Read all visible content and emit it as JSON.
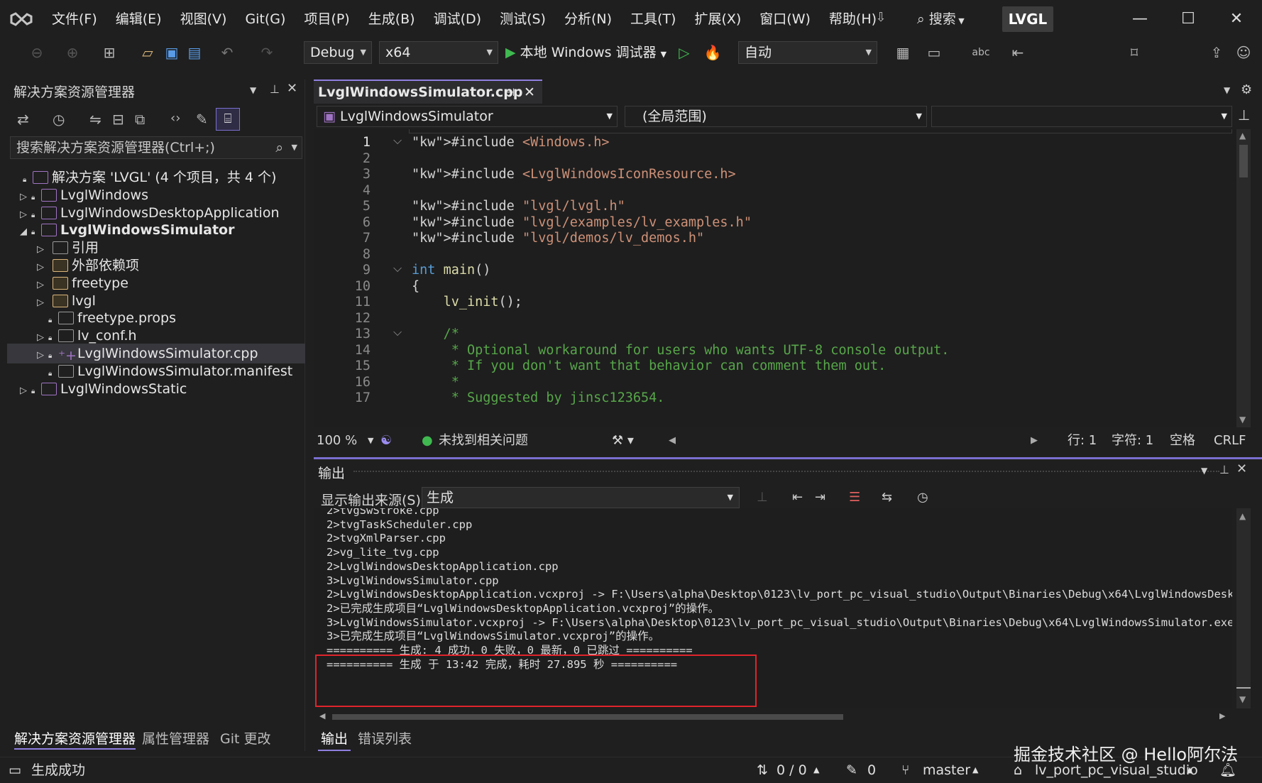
{
  "menu": [
    "文件(F)",
    "编辑(E)",
    "视图(V)",
    "Git(G)",
    "项目(P)",
    "生成(B)",
    "调试(D)",
    "测试(S)",
    "分析(N)",
    "工具(T)",
    "扩展(X)",
    "窗口(W)",
    "帮助(H)"
  ],
  "search_label": "搜索",
  "title_badge": "LVGL",
  "toolbar": {
    "config": "Debug",
    "platform": "x64",
    "debugger": "本地 Windows 调试器",
    "auto": "自动"
  },
  "solution_explorer": {
    "title": "解决方案资源管理器",
    "search_placeholder": "搜索解决方案资源管理器(Ctrl+;)",
    "tree": [
      {
        "label": "解决方案 'LVGL' (4 个项目，共 4 个)",
        "level": 0,
        "expander": "",
        "bold": false
      },
      {
        "label": "LvglWindows",
        "level": 1,
        "expander": "▷",
        "bold": false
      },
      {
        "label": "LvglWindowsDesktopApplication",
        "level": 1,
        "expander": "▷",
        "bold": false
      },
      {
        "label": "LvglWindowsSimulator",
        "level": 1,
        "expander": "◢",
        "bold": true
      },
      {
        "label": "引用",
        "level": 2,
        "expander": "▷",
        "bold": false
      },
      {
        "label": "外部依赖项",
        "level": 2,
        "expander": "▷",
        "bold": false
      },
      {
        "label": "freetype",
        "level": 2,
        "expander": "▷",
        "bold": false
      },
      {
        "label": "lvgl",
        "level": 2,
        "expander": "▷",
        "bold": false
      },
      {
        "label": "freetype.props",
        "level": 2,
        "expander": "",
        "bold": false
      },
      {
        "label": "lv_conf.h",
        "level": 2,
        "expander": "▷",
        "bold": false
      },
      {
        "label": "LvglWindowsSimulator.cpp",
        "level": 2,
        "expander": "▷",
        "bold": false
      },
      {
        "label": "LvglWindowsSimulator.manifest",
        "level": 2,
        "expander": "",
        "bold": false
      },
      {
        "label": "LvglWindowsStatic",
        "level": 1,
        "expander": "▷",
        "bold": false
      }
    ],
    "bottom_tabs": [
      "解决方案资源管理器",
      "属性管理器",
      "Git 更改"
    ]
  },
  "editor": {
    "tab": "LvglWindowsSimulator.cpp",
    "nav_project": "LvglWindowsSimulator",
    "nav_scope": "(全局范围)",
    "lines": [
      {
        "n": "1",
        "t": "#include <Windows.h>"
      },
      {
        "n": "2",
        "t": ""
      },
      {
        "n": "3",
        "t": "#include <LvglWindowsIconResource.h>"
      },
      {
        "n": "4",
        "t": ""
      },
      {
        "n": "5",
        "t": "#include \"lvgl/lvgl.h\""
      },
      {
        "n": "6",
        "t": "#include \"lvgl/examples/lv_examples.h\""
      },
      {
        "n": "7",
        "t": "#include \"lvgl/demos/lv_demos.h\""
      },
      {
        "n": "8",
        "t": ""
      },
      {
        "n": "9",
        "t": "int main()"
      },
      {
        "n": "10",
        "t": "{"
      },
      {
        "n": "11",
        "t": "    lv_init();"
      },
      {
        "n": "12",
        "t": ""
      },
      {
        "n": "13",
        "t": "    /*"
      },
      {
        "n": "14",
        "t": "     * Optional workaround for users who wants UTF-8 console output."
      },
      {
        "n": "15",
        "t": "     * If you don't want that behavior can comment them out."
      },
      {
        "n": "16",
        "t": "     *"
      },
      {
        "n": "17",
        "t": "     * Suggested by jinsc123654."
      }
    ],
    "zoom": "100 %",
    "issues": "未找到相关问题",
    "row": "行: 1",
    "col": "字符: 1",
    "spaces": "空格",
    "eol": "CRLF"
  },
  "output": {
    "title": "输出",
    "source_label": "显示输出来源(S):",
    "source_value": "生成",
    "lines": [
      "2>tvgSwStroke.cpp",
      "2>tvgTaskScheduler.cpp",
      "2>tvgXmlParser.cpp",
      "2>vg_lite_tvg.cpp",
      "2>LvglWindowsDesktopApplication.cpp",
      "3>LvglWindowsSimulator.cpp",
      "2>LvglWindowsDesktopApplication.vcxproj -> F:\\Users\\alpha\\Desktop\\0123\\lv_port_pc_visual_studio\\Output\\Binaries\\Debug\\x64\\LvglWindowsDesktopAp",
      "2>已完成生成项目“LvglWindowsDesktopApplication.vcxproj”的操作。",
      "3>LvglWindowsSimulator.vcxproj -> F:\\Users\\alpha\\Desktop\\0123\\lv_port_pc_visual_studio\\Output\\Binaries\\Debug\\x64\\LvglWindowsSimulator.exe",
      "3>已完成生成项目“LvglWindowsSimulator.vcxproj”的操作。",
      "========== 生成: 4 成功，0 失败，0 最新，0 已跳过 ==========",
      "========== 生成 于 13:42 完成，耗时 27.895 秒 =========="
    ],
    "tabs": [
      "输出",
      "错误列表"
    ]
  },
  "statusbar": {
    "message": "生成成功",
    "changes": "0 / 0",
    "pending": "0",
    "branch": "master",
    "repo": "lv_port_pc_visual_studio"
  },
  "watermark": "掘金技术社区 @ Hello阿尔法",
  "colors": {
    "accent": "#8f7fe0",
    "highlight_box": "#e0242c",
    "play_green": "#3fb950",
    "folder_yellow": "#dcb67a"
  }
}
